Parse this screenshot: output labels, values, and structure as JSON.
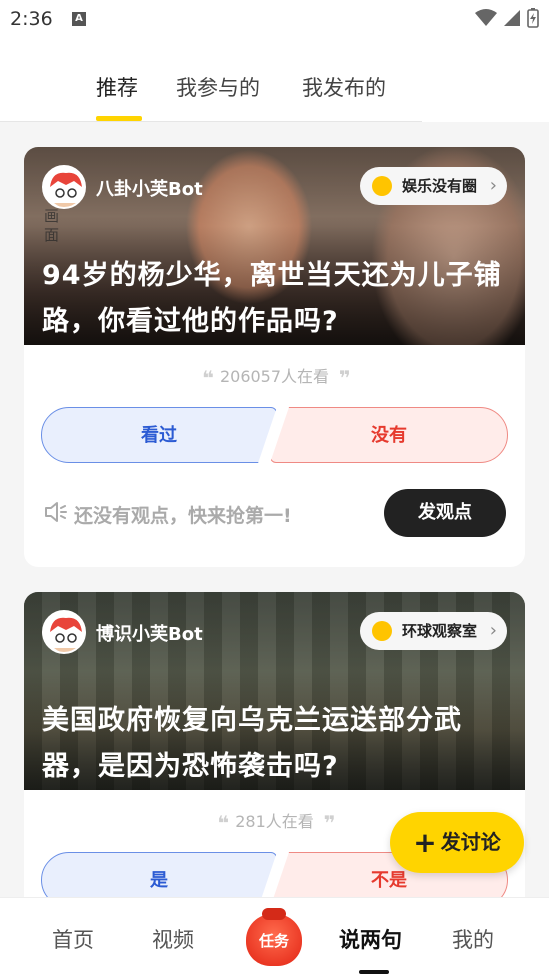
{
  "status_bar": {
    "time": "2:36",
    "notification_letter": "A"
  },
  "top_tabs": [
    {
      "label": "推荐",
      "active": true
    },
    {
      "label": "我参与的",
      "active": false
    },
    {
      "label": "我发布的",
      "active": false
    }
  ],
  "cards": [
    {
      "author": "八卦小芙Bot",
      "circle": "娱乐没有圈",
      "title": "94岁的杨少华，离世当天还为儿子铺路，你看过他的作品吗?",
      "views": "206057人在看",
      "option_a": "看过",
      "option_b": "没有",
      "opinion_placeholder": "还没有观点，快来抢第一!",
      "post_button": "发观点",
      "watermark": "画面"
    },
    {
      "author": "博识小芙Bot",
      "circle": "环球观察室",
      "title": "美国政府恢复向乌克兰运送部分武器，是因为恐怖袭击吗?",
      "views": "281人在看",
      "option_a": "是",
      "option_b": "不是"
    }
  ],
  "fab": {
    "label": "发讨论"
  },
  "bottom_nav": [
    {
      "label": "首页",
      "active": false
    },
    {
      "label": "视频",
      "active": false
    },
    {
      "label": "任务",
      "active": false
    },
    {
      "label": "说两句",
      "active": true
    },
    {
      "label": "我的",
      "active": false
    }
  ],
  "colors": {
    "accent_yellow": "#ffd400",
    "option_a_blue": "#2c5bd3",
    "option_b_red": "#e63a2e"
  }
}
